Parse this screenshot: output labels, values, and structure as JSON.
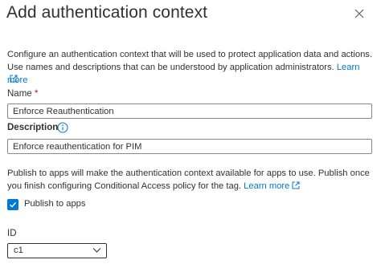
{
  "panel": {
    "title": "Add authentication context",
    "close_icon": "close-icon"
  },
  "intro": {
    "text": "Configure an authentication context that will be used to protect application data and actions. Use names and descriptions that can be understood by application administrators.",
    "learn_more": "Learn more",
    "link_icon": "external-link-icon"
  },
  "name_field": {
    "label": "Name",
    "required_marker": "*",
    "value": "Enforce Reauthentication"
  },
  "description_field": {
    "label": "Description",
    "info_icon": "info-icon",
    "value": "Enforce reauthentication for PIM"
  },
  "publish": {
    "text": "Publish to apps will make the authentication context available for apps to use. Publish once you finish configuring Conditional Access policy for the tag.",
    "learn_more": "Learn more",
    "checkbox_label": "Publish to apps",
    "checked": true
  },
  "id_field": {
    "label": "ID",
    "selected": "c1"
  },
  "colors": {
    "accent": "#0078d4",
    "required": "#a4262c",
    "text": "#323130"
  }
}
